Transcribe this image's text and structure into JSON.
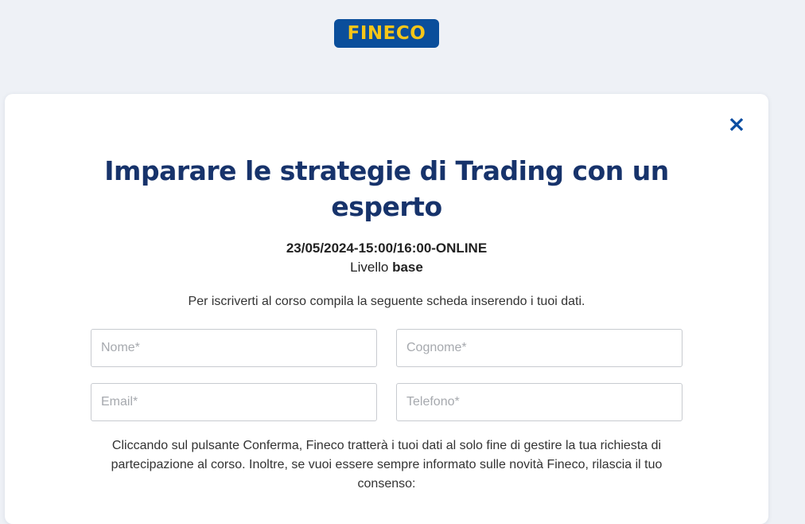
{
  "logo": {
    "text": "FINECO"
  },
  "modal": {
    "close_icon": "×",
    "title_line1": "Imparare le strategie di Trading con un",
    "title_line2": "esperto",
    "date": "23/05/2024-15:00/16:00-ONLINE",
    "level_label": "Livello",
    "level_value": "base",
    "intro": "Per iscriverti al corso compila la seguente scheda inserendo i tuoi dati.",
    "form": {
      "nome_placeholder": "Nome*",
      "cognome_placeholder": "Cognome*",
      "email_placeholder": "Email*",
      "telefono_placeholder": "Telefono*"
    },
    "consent_text": "Cliccando sul pulsante Conferma, Fineco tratterà i tuoi dati al solo fine di gestire la tua richiesta di partecipazione al corso. Inoltre, se vuoi essere sempre informato sulle novità Fineco, rilascia il tuo consenso:"
  },
  "colors": {
    "brand_blue": "#0a4e9b",
    "brand_yellow": "#f5c518",
    "title_navy": "#17336b",
    "background": "#eef1f6"
  }
}
